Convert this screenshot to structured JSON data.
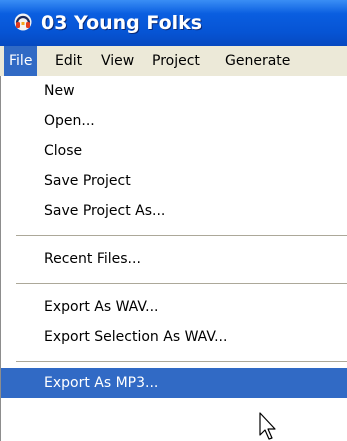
{
  "window": {
    "title": "03 Young Folks",
    "icon": "audacity-headphones-icon"
  },
  "menubar": {
    "items": [
      "File",
      "Edit",
      "View",
      "Project",
      "Generate"
    ],
    "active": "File"
  },
  "file_menu": {
    "items": [
      "New",
      "Open...",
      "Close",
      "Save Project",
      "Save Project As...",
      "Recent Files...",
      "Export As WAV...",
      "Export Selection As WAV...",
      "Export As MP3..."
    ],
    "highlighted": "Export As MP3..."
  },
  "colors": {
    "titlebar": "#0654d4",
    "menubar": "#ece9d8",
    "highlight": "#316ac5"
  }
}
